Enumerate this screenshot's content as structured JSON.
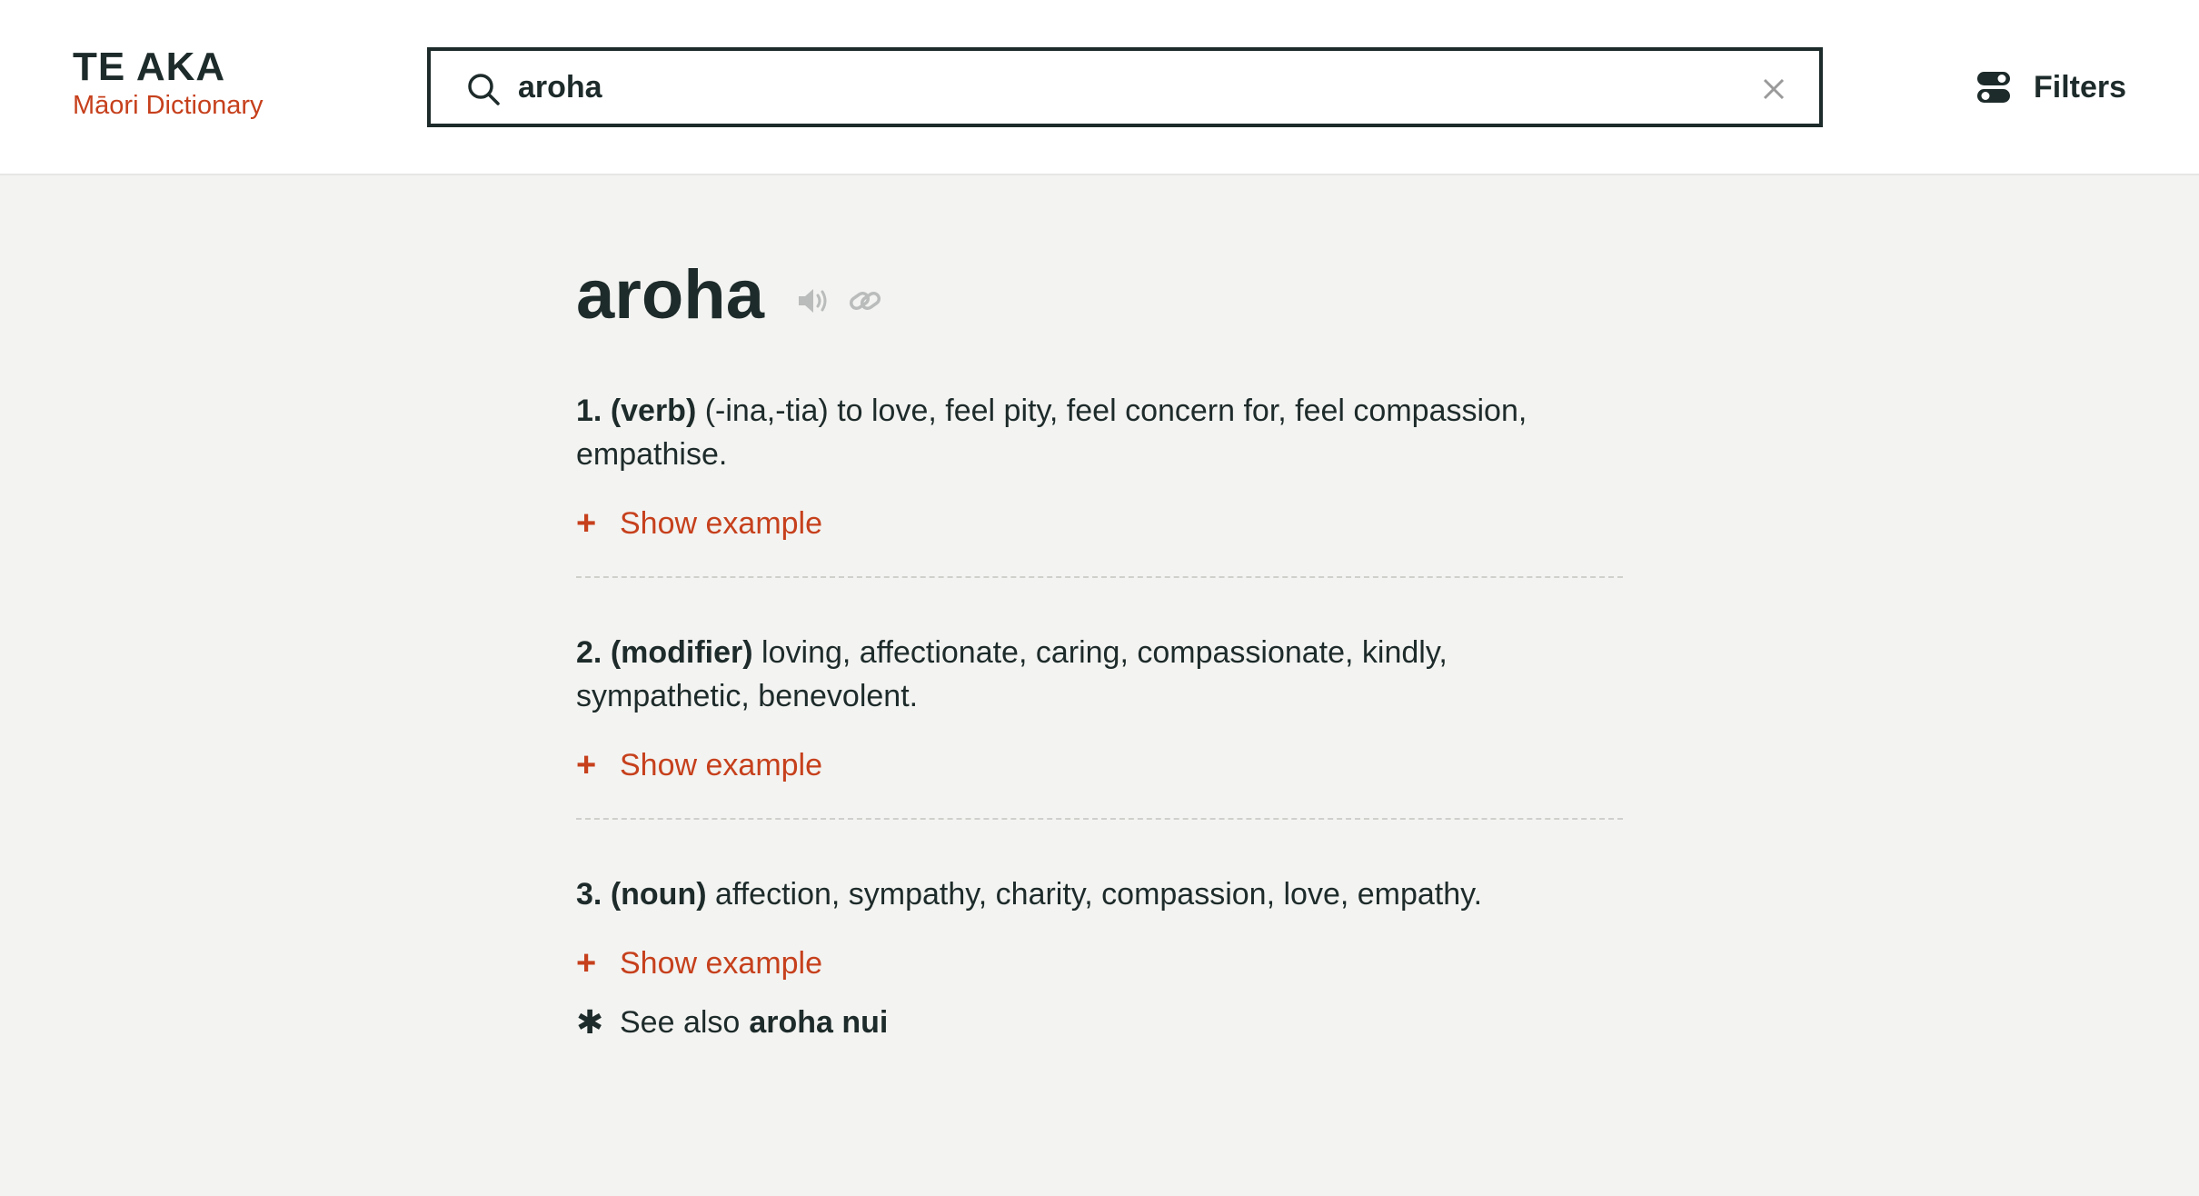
{
  "header": {
    "logo_title": "TE AKA",
    "logo_subtitle": "Māori Dictionary",
    "search_value": "aroha",
    "search_icon": "search-icon",
    "clear_icon": "close-icon",
    "filters_label": "Filters",
    "filters_icon": "toggle-icon"
  },
  "entry": {
    "headword": "aroha",
    "audio_icon": "speaker-icon",
    "link_icon": "link-icon",
    "senses": [
      {
        "number": "1.",
        "pos": "(verb)",
        "definition": "(-ina,-tia) to love, feel pity, feel concern for, feel compassion, empathise.",
        "show_example": "Show example"
      },
      {
        "number": "2.",
        "pos": "(modifier)",
        "definition": "loving, affectionate, caring, compassionate, kindly, sympathetic, benevolent.",
        "show_example": "Show example"
      },
      {
        "number": "3.",
        "pos": "(noun)",
        "definition": "affection, sympathy, charity, compassion, love, empathy.",
        "show_example": "Show example",
        "see_also_label": "See also",
        "see_also_word": "aroha nui"
      }
    ]
  },
  "colors": {
    "accent": "#c6401c",
    "text": "#1d2b2a",
    "background": "#f3f3f1"
  }
}
